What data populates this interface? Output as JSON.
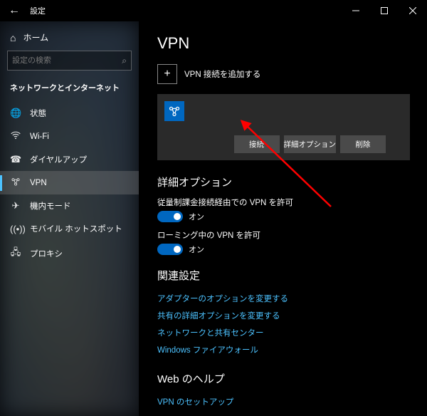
{
  "titlebar": {
    "title": "設定"
  },
  "sidebar": {
    "home_label": "ホーム",
    "search_placeholder": "設定の検索",
    "category_label": "ネットワークとインターネット",
    "items": [
      {
        "label": "状態"
      },
      {
        "label": "Wi-Fi"
      },
      {
        "label": "ダイヤルアップ"
      },
      {
        "label": "VPN"
      },
      {
        "label": "機内モード"
      },
      {
        "label": "モバイル ホットスポット"
      },
      {
        "label": "プロキシ"
      }
    ]
  },
  "main": {
    "heading": "VPN",
    "add_label": "VPN 接続を追加する",
    "card": {
      "connect_label": "接続",
      "advanced_label": "詳細オプション",
      "delete_label": "削除"
    },
    "advanced_section_title": "詳細オプション",
    "opt_metered": {
      "label": "従量制課金接続経由での VPN を許可",
      "state": "オン"
    },
    "opt_roaming": {
      "label": "ローミング中の VPN を許可",
      "state": "オン"
    },
    "related_title": "関連設定",
    "related_links": [
      "アダプターのオプションを変更する",
      "共有の詳細オプションを変更する",
      "ネットワークと共有センター",
      "Windows ファイアウォール"
    ],
    "webhelp_title": "Web のヘルプ",
    "webhelp_links": [
      "VPN のセットアップ"
    ]
  }
}
